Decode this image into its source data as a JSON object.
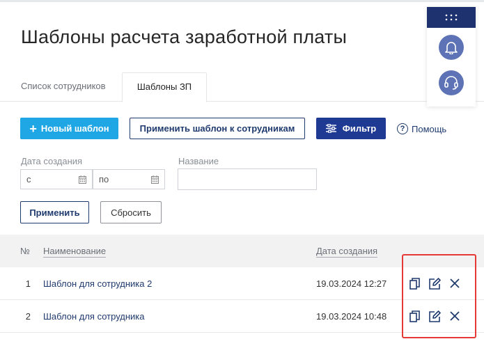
{
  "page": {
    "title": "Шаблоны расчета заработной платы"
  },
  "tabs": [
    {
      "label": "Список сотрудников",
      "active": false
    },
    {
      "label": "Шаблоны ЗП",
      "active": true
    }
  ],
  "toolbar": {
    "new_template": "Новый шаблон",
    "apply_template": "Применить шаблон к сотрудникам",
    "filter": "Фильтр",
    "help": "Помощь"
  },
  "filters": {
    "date_label": "Дата создания",
    "date_from_placeholder": "с",
    "date_to_placeholder": "по",
    "name_label": "Название",
    "name_value": "",
    "apply": "Применить",
    "reset": "Сбросить"
  },
  "table": {
    "headers": {
      "num": "№",
      "name": "Наименование",
      "date": "Дата создания"
    },
    "rows": [
      {
        "num": "1",
        "name": "Шаблон для сотрудника 2",
        "date": "19.03.2024 12:27"
      },
      {
        "num": "2",
        "name": "Шаблон для сотрудника",
        "date": "19.03.2024 10:48"
      }
    ]
  },
  "icons": {
    "copy": "copy-icon",
    "edit": "edit-icon",
    "delete": "close-icon",
    "apps": "grid-dots-icon",
    "notifications": "bell-icon",
    "support": "headset-icon"
  },
  "colors": {
    "primary_dark": "#1f3a6e",
    "accent_blue": "#1ea7e4",
    "filter_blue": "#1f3a93",
    "highlight_red": "#e53935",
    "panel_circle": "#5d73b5"
  }
}
